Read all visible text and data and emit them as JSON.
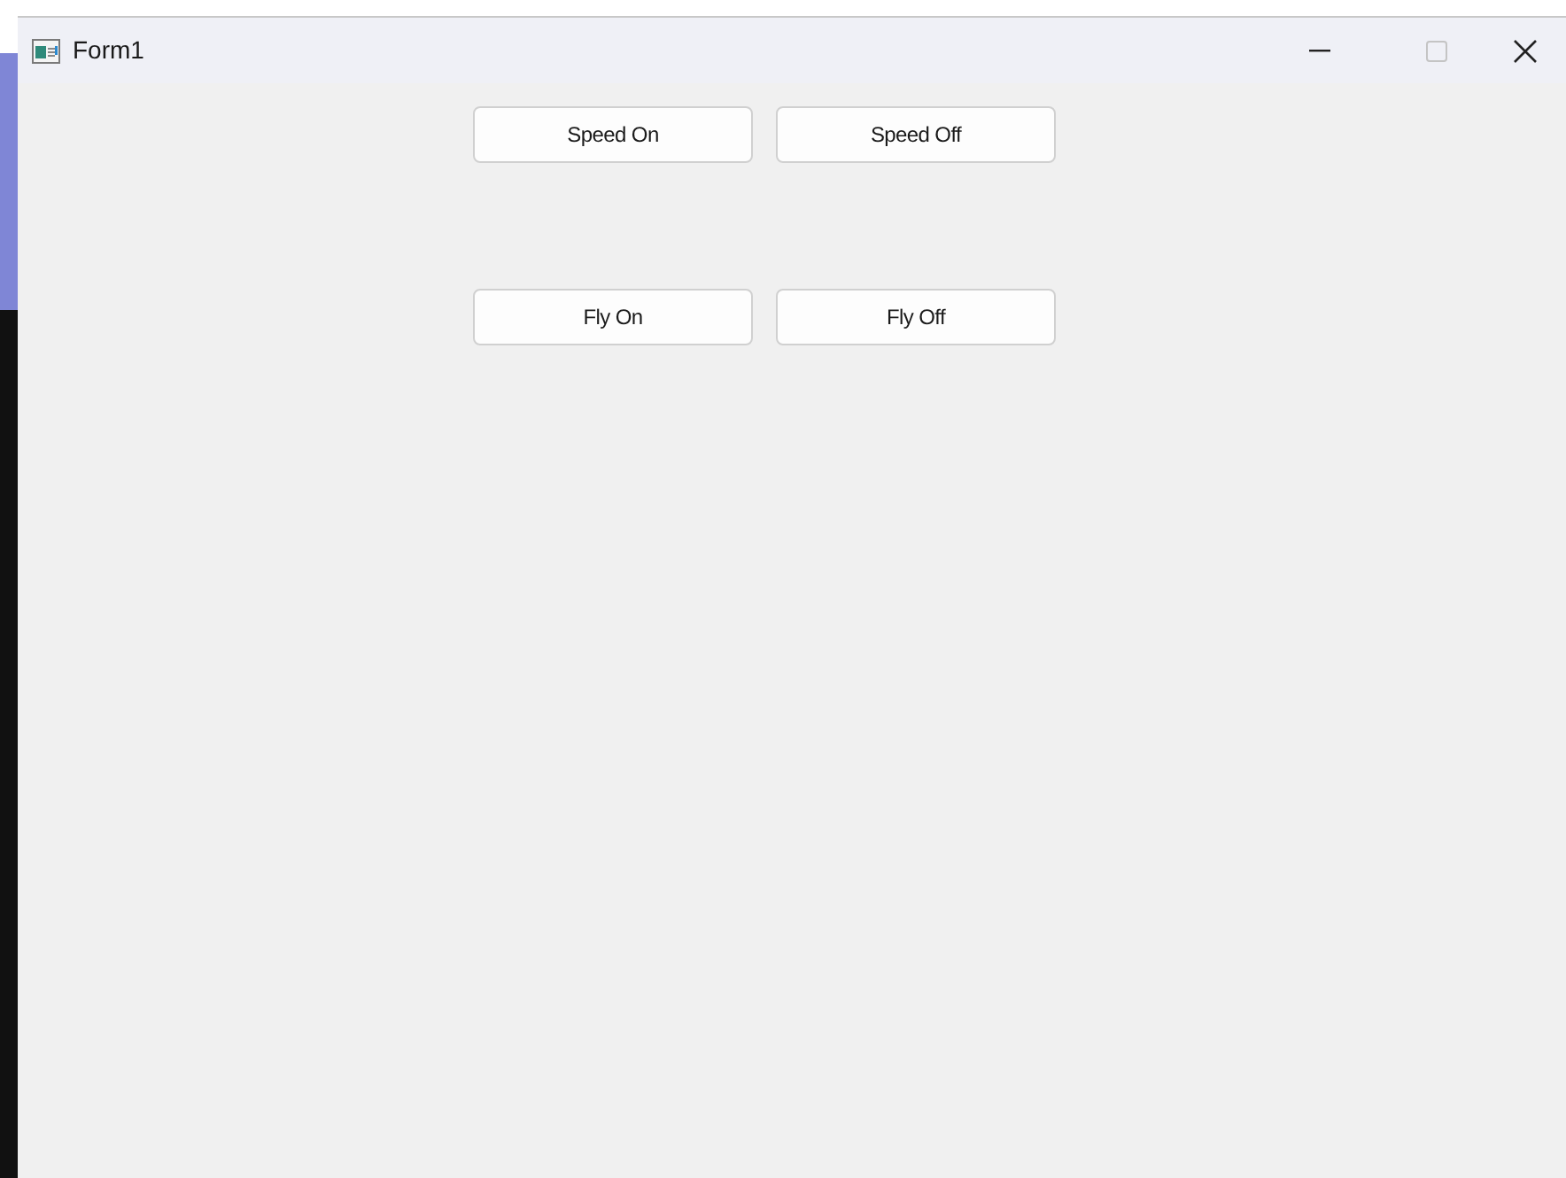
{
  "window": {
    "title": "Form1",
    "maximize_disabled": true
  },
  "button_rows": [
    {
      "buttons": [
        "Speed On",
        "Speed Off"
      ]
    },
    {
      "buttons": [
        "Fly On",
        "Fly Off"
      ]
    }
  ]
}
